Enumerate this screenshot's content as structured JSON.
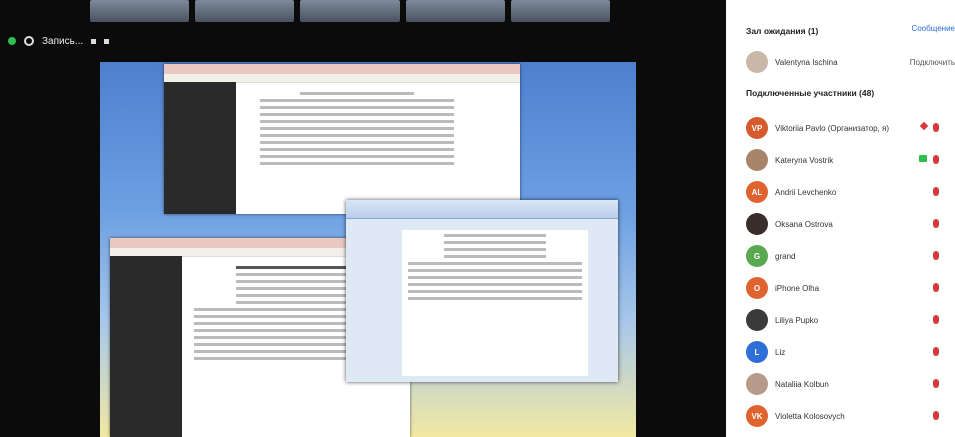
{
  "meeting": {
    "host_label": "Запись..."
  },
  "waiting": {
    "header": "Зал ожидания (1)",
    "message_button": "Сообщение",
    "person": {
      "name": "Valentyna Ischina",
      "action": "Подключить"
    }
  },
  "participants": {
    "header": "Подключенные участники (48)",
    "items": [
      {
        "initials": "VP",
        "name": "Viktoriia Pavlo (Организатор, я)",
        "color": "#d65a2c"
      },
      {
        "initials": "",
        "name": "Kateryna Vostrik",
        "color": "#a8856a"
      },
      {
        "initials": "AL",
        "name": "Andrii Levchenko",
        "color": "#e0632f"
      },
      {
        "initials": "",
        "name": "Oksana Ostrova",
        "color": "#3b2e2a"
      },
      {
        "initials": "G",
        "name": "grand",
        "color": "#5aa84f"
      },
      {
        "initials": "O",
        "name": "iPhone Olha",
        "color": "#e0632f"
      },
      {
        "initials": "",
        "name": "Liliya Pupko",
        "color": "#3a3a3a"
      },
      {
        "initials": "L",
        "name": "Liz",
        "color": "#2d6fd6"
      },
      {
        "initials": "",
        "name": "Nataliia Kolbun",
        "color": "#b79a8a"
      },
      {
        "initials": "VK",
        "name": "Violetta Kolosovych",
        "color": "#e0632f"
      }
    ]
  }
}
